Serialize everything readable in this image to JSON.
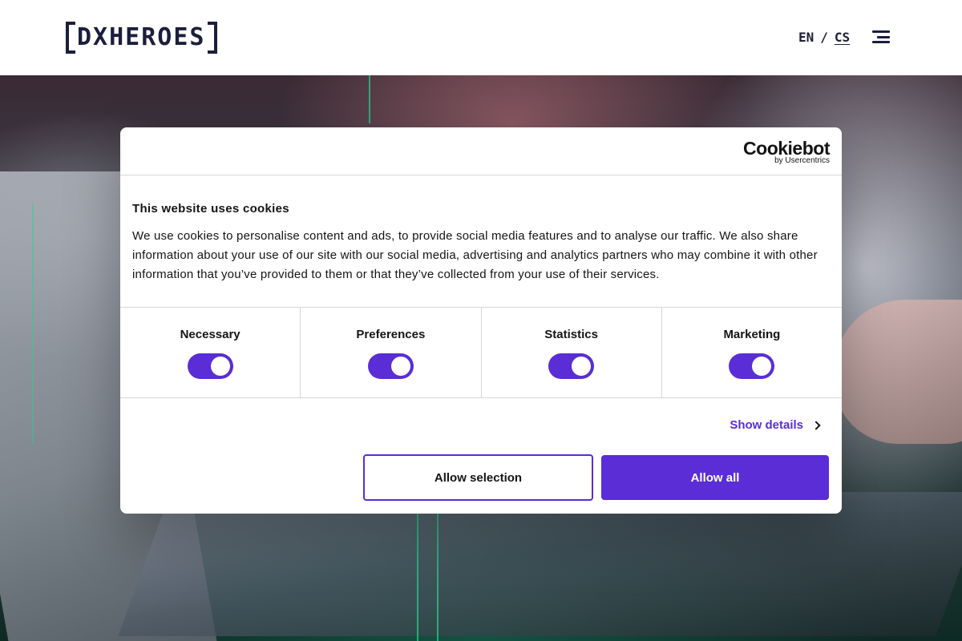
{
  "header": {
    "logo_text": "DXHEROES",
    "languages": [
      {
        "code": "EN",
        "active": false
      },
      {
        "code": "CS",
        "active": true
      }
    ],
    "lang_separator": "/",
    "menu_icon": "hamburger-menu-icon"
  },
  "cookie_dialog": {
    "brand": {
      "name": "Cookiebot",
      "sub": "by Usercentrics"
    },
    "title": "This website uses cookies",
    "description": "We use cookies to personalise content and ads, to provide social media features and to analyse our traffic. We also share information about your use of our site with our social media, advertising and analytics partners who may combine it with other information that you’ve provided to them or that they’ve collected from your use of their services.",
    "categories": [
      {
        "label": "Necessary",
        "enabled": true
      },
      {
        "label": "Preferences",
        "enabled": true
      },
      {
        "label": "Statistics",
        "enabled": true
      },
      {
        "label": "Marketing",
        "enabled": true
      }
    ],
    "show_details_label": "Show details",
    "allow_selection_label": "Allow selection",
    "allow_all_label": "Allow all"
  },
  "colors": {
    "brand_navy": "#1b1f3b",
    "accent_purple": "#5a2dd6",
    "text": "#141414",
    "divider": "#d6d6d6"
  }
}
